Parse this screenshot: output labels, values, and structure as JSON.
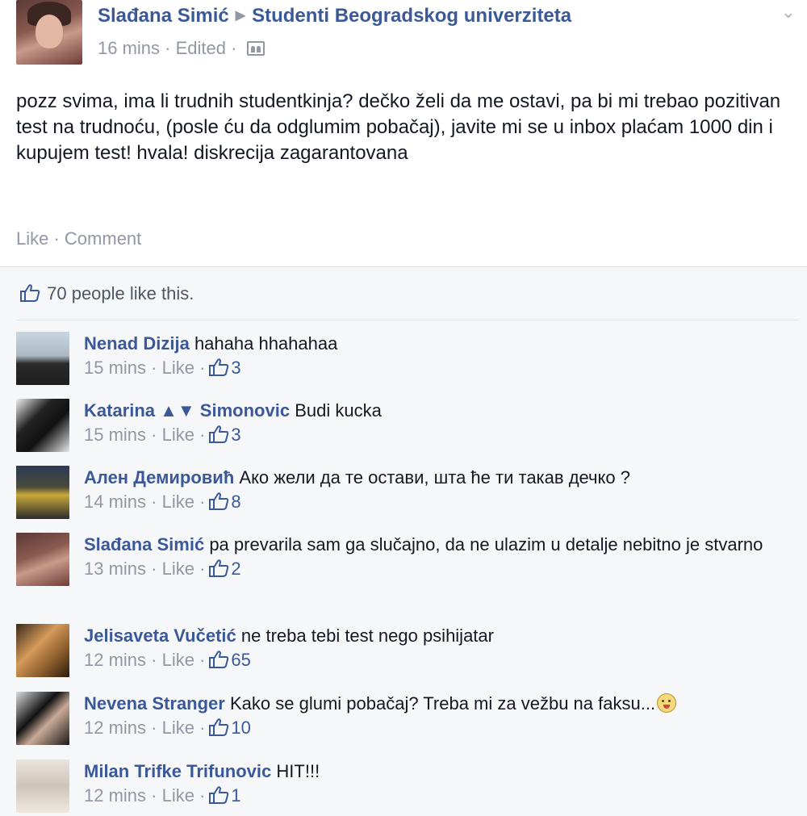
{
  "post": {
    "author": "Slađana Simić",
    "group": "Studenti Beogradskog univerziteta",
    "time": "16 mins",
    "edited": "Edited",
    "text": "pozz svima, ima li trudnih studentkinja? dečko želi da me ostavi, pa bi mi trebao pozitivan test na trudnoću, (posle ću da odglumim pobačaj), javite mi se u inbox plaćam 1000 din i kupujem test! hvala! diskrecija zagarantovana",
    "like_label": "Like",
    "comment_label": "Comment",
    "likes_summary": "70 people like this."
  },
  "colors": {
    "link_blue": "#3b5998",
    "meta_gray": "#9197a3",
    "comment_bg": "#f6f7f8"
  },
  "comments": [
    {
      "author": "Nenad Dizija",
      "text": "hahaha hhahahaa",
      "time": "15 mins",
      "like_label": "Like",
      "likes": "3"
    },
    {
      "author": "Katarina ▲▼ Simonovic",
      "text": "Budi kucka",
      "time": "15 mins",
      "like_label": "Like",
      "likes": "3"
    },
    {
      "author": "Ален Демировић",
      "text": "Ако жели да те остави, шта ће ти такав дечко ?",
      "time": "14 mins",
      "like_label": "Like",
      "likes": "8"
    },
    {
      "author": "Slađana Simić",
      "text": "pa prevarila sam ga slučajno, da ne ulazim u detalje nebitno je stvarno",
      "time": "13 mins",
      "like_label": "Like",
      "likes": "2"
    },
    {
      "author": "Jelisaveta Vučetić",
      "text": "ne treba tebi test nego psihijatar",
      "time": "12 mins",
      "like_label": "Like",
      "likes": "65"
    },
    {
      "author": "Nevena Stranger",
      "text": "Kako se glumi pobačaj? Treba mi za vežbu na faksu...",
      "time": "12 mins",
      "like_label": "Like",
      "likes": "10",
      "emoji": "tongue-out-emoji"
    },
    {
      "author": "Milan Trifke Trifunovic",
      "text": "HIT!!!",
      "time": "12 mins",
      "like_label": "Like",
      "likes": "1"
    }
  ]
}
